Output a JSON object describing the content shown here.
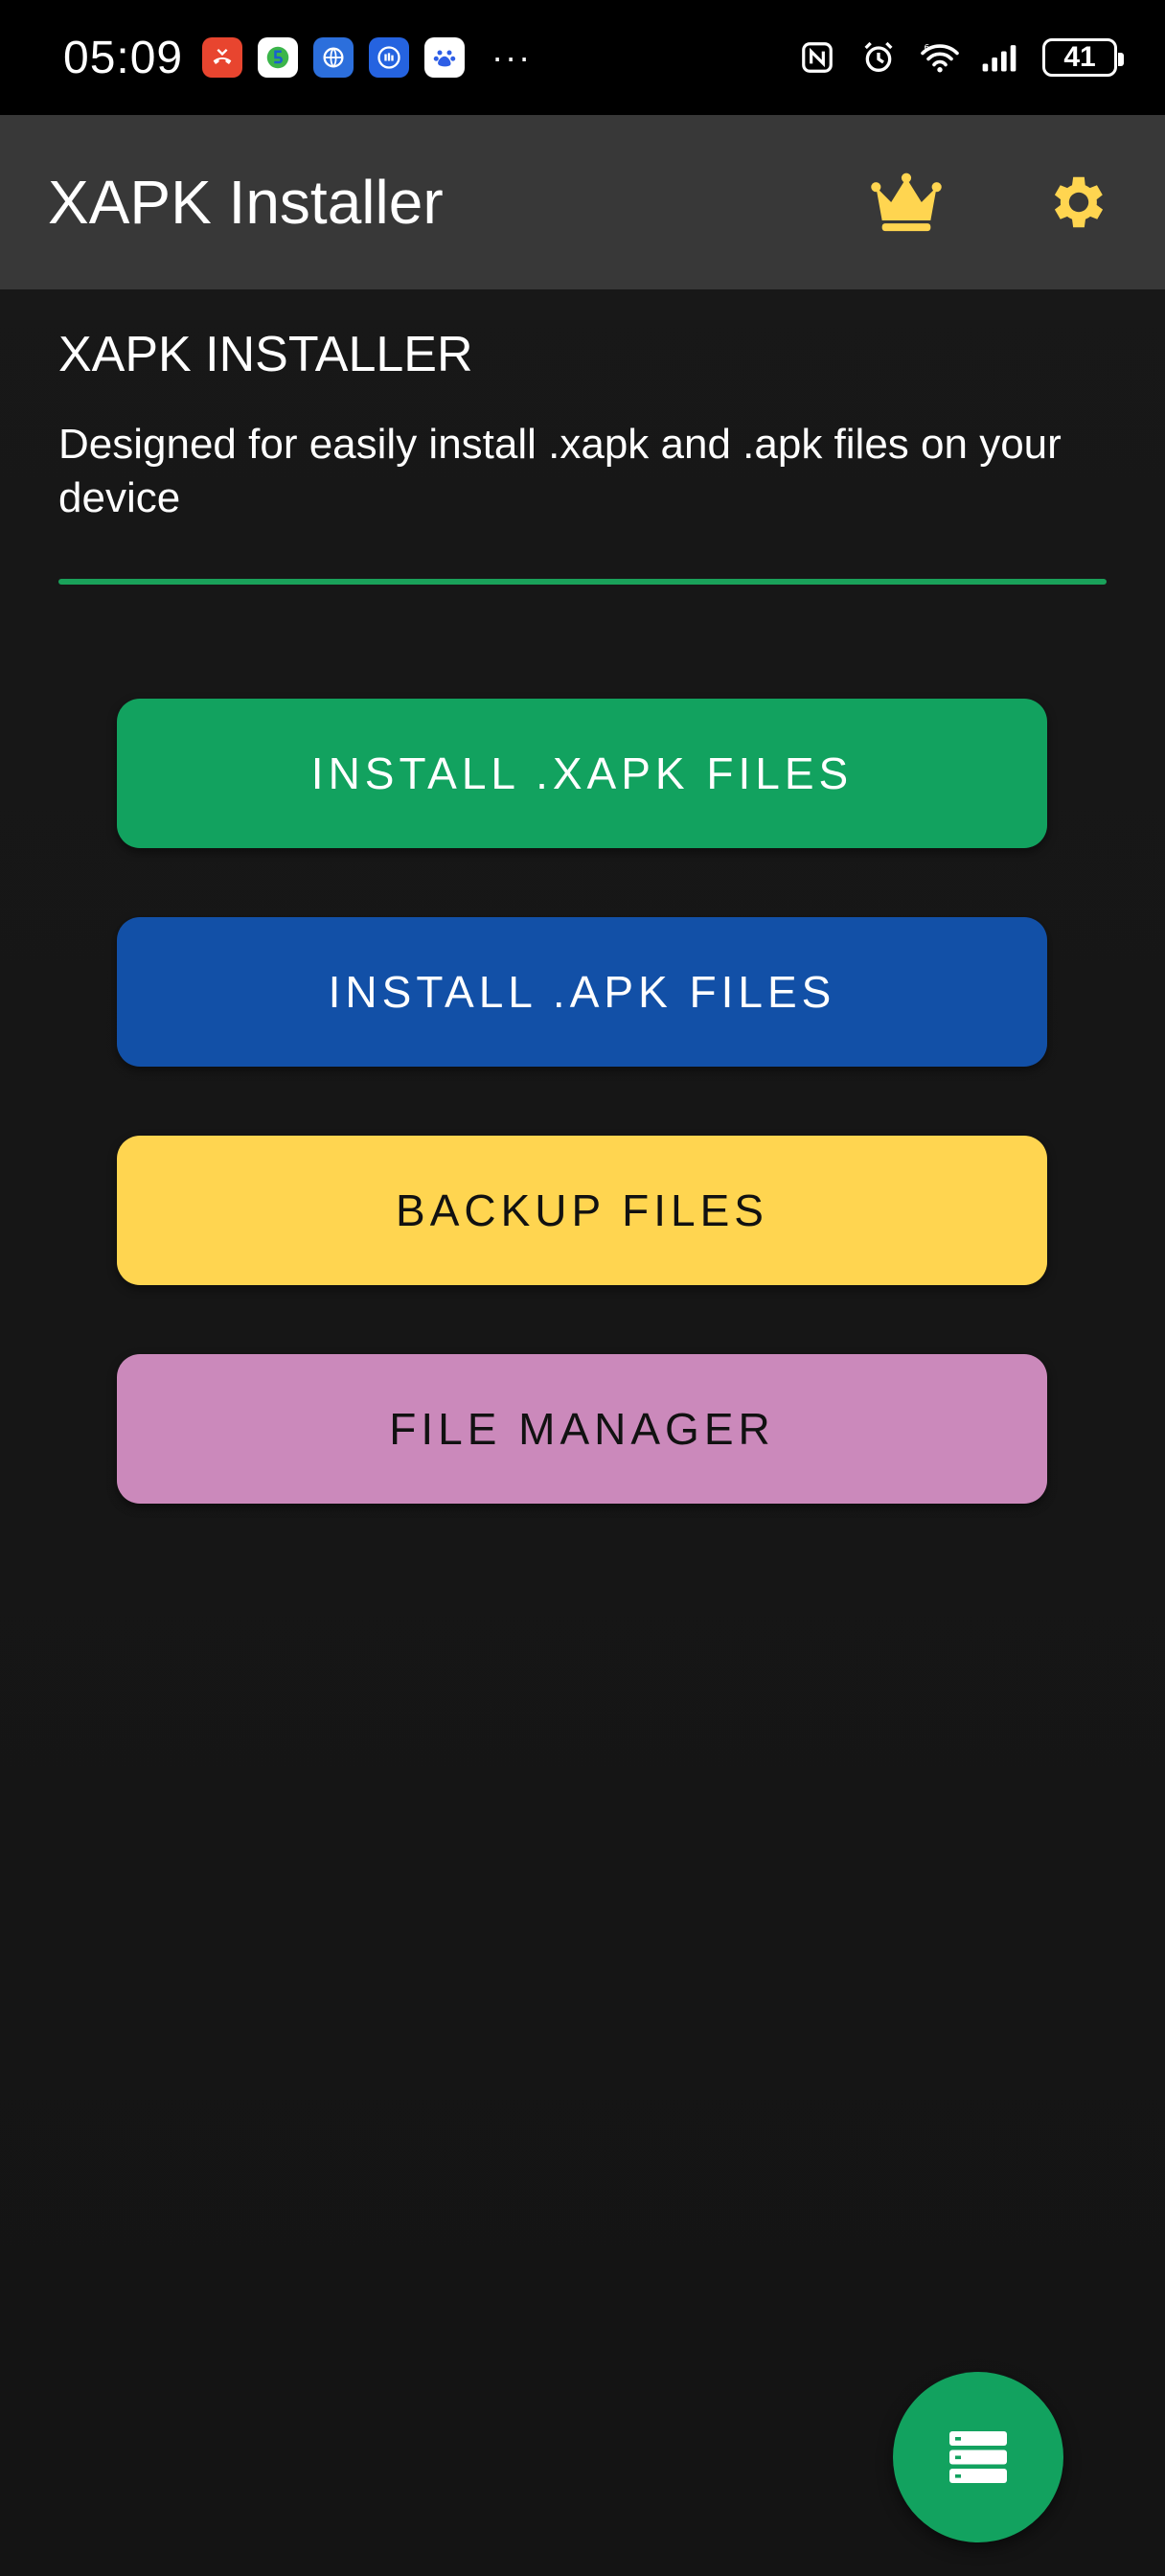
{
  "status_bar": {
    "time": "05:09",
    "battery_level": "41"
  },
  "app_bar": {
    "title": "XAPK Installer"
  },
  "header": {
    "section_title": "XAPK INSTALLER",
    "description": "Designed for easily install .xapk and .apk files on your device"
  },
  "buttons": {
    "install_xapk": "INSTALL .XAPK FILES",
    "install_apk": "INSTALL .APK FILES",
    "backup": "BACKUP FILES",
    "file_manager": "FILE MANAGER"
  },
  "colors": {
    "accent_green": "#12a25f",
    "blue": "#1250a7",
    "yellow": "#ffd550",
    "pink": "#cb89bb",
    "app_bar": "#383838",
    "background": "#151515"
  },
  "icons": {
    "premium": "crown-icon",
    "settings": "gear-icon",
    "fab": "storage-list-icon"
  }
}
